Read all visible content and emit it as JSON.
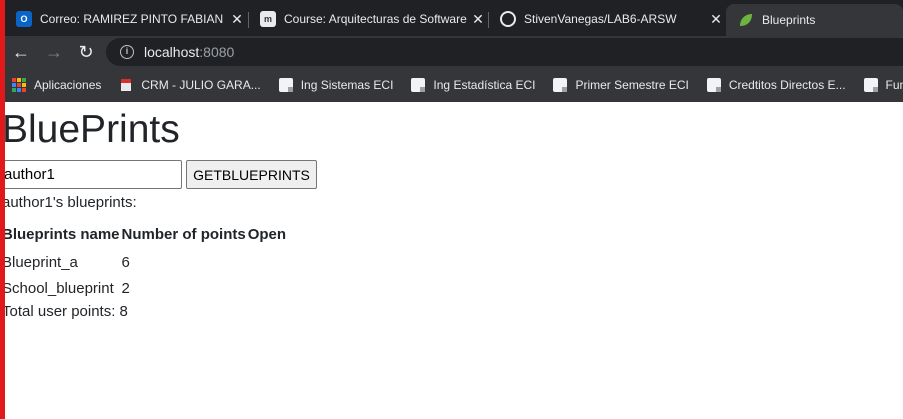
{
  "browser": {
    "tabs": [
      {
        "title": "Correo: RAMIREZ PINTO FABIAN",
        "icon": "outlook-icon",
        "active": false
      },
      {
        "title": "Course: Arquitecturas de Software",
        "icon": "moodle-icon",
        "active": false
      },
      {
        "title": "StivenVanegas/LAB6-ARSW",
        "icon": "github-icon",
        "active": false
      },
      {
        "title": "Blueprints",
        "icon": "spring-leaf-icon",
        "active": true
      }
    ],
    "address": {
      "host": "localhost",
      "port": ":8080"
    },
    "bookmarks": [
      {
        "label": "Aplicaciones",
        "icon": "apps-grid-icon"
      },
      {
        "label": "CRM - JULIO GARA...",
        "icon": "crm-icon"
      },
      {
        "label": "Ing Sistemas ECI",
        "icon": "page-icon"
      },
      {
        "label": "Ing Estadística ECI",
        "icon": "page-icon"
      },
      {
        "label": "Primer Semestre ECI",
        "icon": "page-icon"
      },
      {
        "label": "Credtitos Directos E...",
        "icon": "page-icon"
      },
      {
        "label": "Funcion",
        "icon": "page-icon"
      }
    ]
  },
  "page": {
    "title": "BluePrints",
    "author_value": "author1",
    "button_label": "GETBLUEPRINTS",
    "caption": "author1's blueprints:",
    "table": {
      "headers": [
        "Blueprints name",
        "Number of points",
        "Open"
      ],
      "rows": [
        {
          "name": "Blueprint_a",
          "points": "6",
          "open": ""
        },
        {
          "name": "School_blueprint",
          "points": "2",
          "open": ""
        }
      ]
    },
    "total": "Total user points: 8"
  },
  "colors": {
    "accent_border": "#e0191b",
    "chrome_dark": "#202124",
    "chrome_toolbar": "#35363a"
  }
}
